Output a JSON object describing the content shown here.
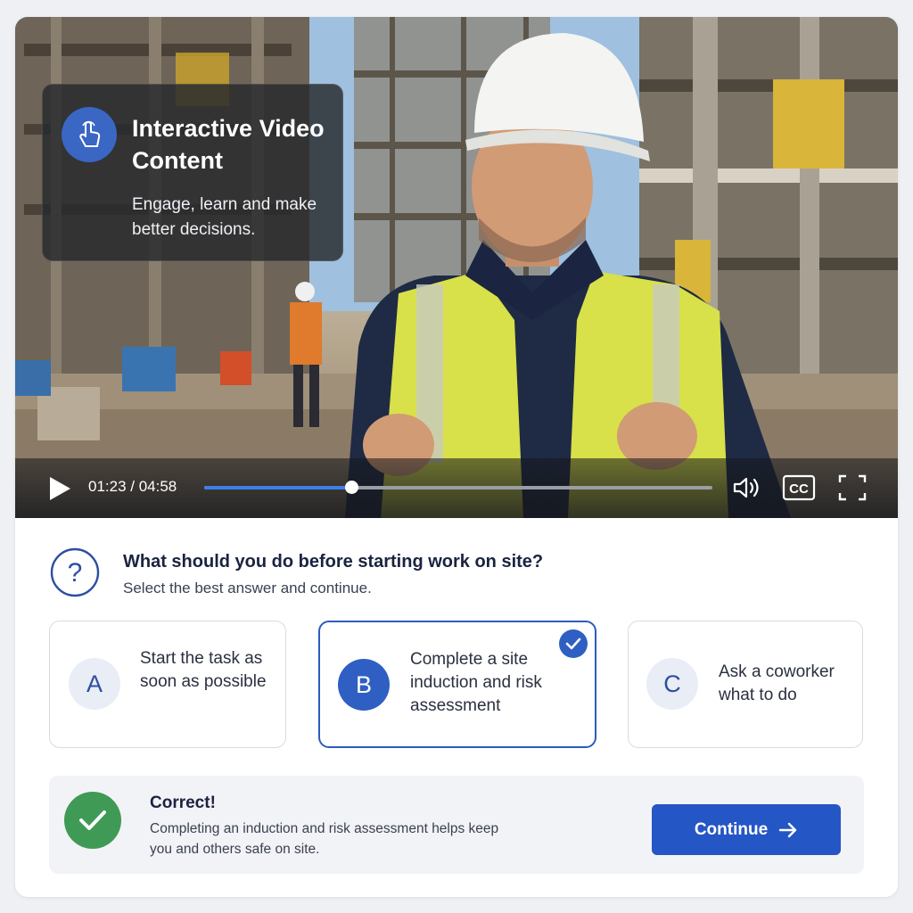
{
  "colors": {
    "accent": "#2556c5",
    "selected_border": "#2d5bbd",
    "correct": "#3f9a55",
    "progress": "#3f7ee8"
  },
  "video": {
    "overlay": {
      "icon": "hand-pointer-icon",
      "title": "Interactive Video Content",
      "subtitle": "Engage, learn and make better decisions."
    },
    "controls": {
      "play_icon": "play-icon",
      "time": "01:23 / 04:58",
      "progress": 0.29,
      "volume_icon": "volume-icon",
      "cc_label": "CC",
      "fullscreen_icon": "fullscreen-icon"
    }
  },
  "question": {
    "icon": "question-circle-icon",
    "title": "What should you do before starting work on site?",
    "subtitle": "Select the best answer and continue.",
    "options": [
      {
        "letter": "A",
        "text": "Start the task as soon as possible",
        "selected": false
      },
      {
        "letter": "B",
        "text": "Complete a site induction and risk assessment",
        "selected": true
      },
      {
        "letter": "C",
        "text": "Ask a coworker what to do",
        "selected": false
      }
    ]
  },
  "feedback": {
    "icon": "check-circle-icon",
    "title": "Correct!",
    "text": "Completing an induction and risk assessment helps keep you and others safe on site.",
    "button_label": "Continue",
    "button_icon": "arrow-right-icon"
  }
}
